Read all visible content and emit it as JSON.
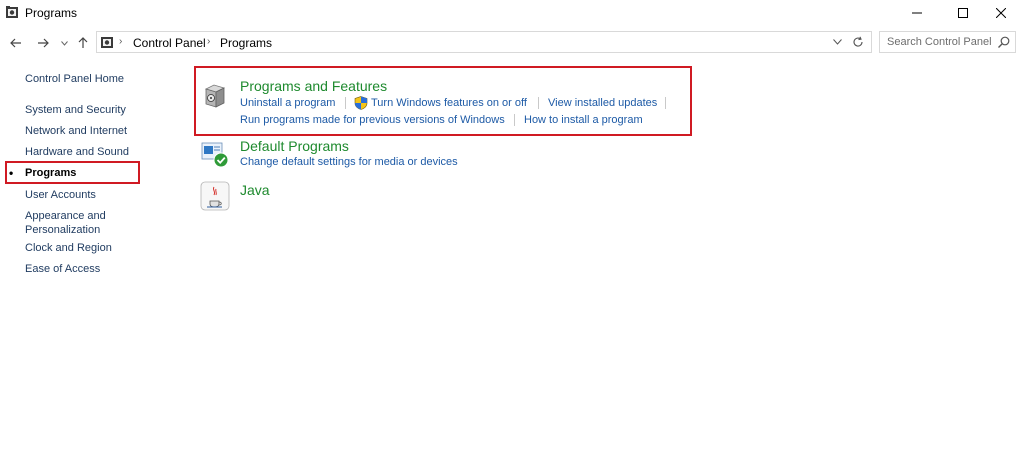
{
  "window": {
    "title": "Programs"
  },
  "address": {
    "crumbs": [
      "Control Panel",
      "Programs"
    ]
  },
  "search": {
    "placeholder": "Search Control Panel"
  },
  "sidebar": {
    "items": [
      {
        "label": "Control Panel Home"
      },
      {
        "label": "System and Security"
      },
      {
        "label": "Network and Internet"
      },
      {
        "label": "Hardware and Sound"
      },
      {
        "label": "Programs",
        "active": true
      },
      {
        "label": "User Accounts"
      },
      {
        "label": "Appearance and"
      },
      {
        "label": "Personalization"
      },
      {
        "label": "Clock and Region"
      },
      {
        "label": "Ease of Access"
      }
    ]
  },
  "categories": {
    "programs_features": {
      "title": "Programs and Features",
      "links": [
        "Uninstall a program",
        "Turn Windows features on or off",
        "View installed updates",
        "Run programs made for previous versions of Windows",
        "How to install a program"
      ]
    },
    "default_programs": {
      "title": "Default Programs",
      "links": [
        "Change default settings for media or devices"
      ]
    },
    "java": {
      "title": "Java"
    }
  },
  "colors": {
    "highlight": "#d01a23",
    "category_title": "#1e8a2e",
    "link": "#1d5aa6"
  },
  "icons": {
    "app": "control-panel-icon",
    "minimize": "minimize-icon",
    "maximize": "maximize-icon",
    "close": "close-icon",
    "back": "back-arrow-icon",
    "forward": "forward-arrow-icon",
    "up": "up-arrow-icon",
    "refresh": "refresh-icon",
    "search": "search-icon"
  }
}
